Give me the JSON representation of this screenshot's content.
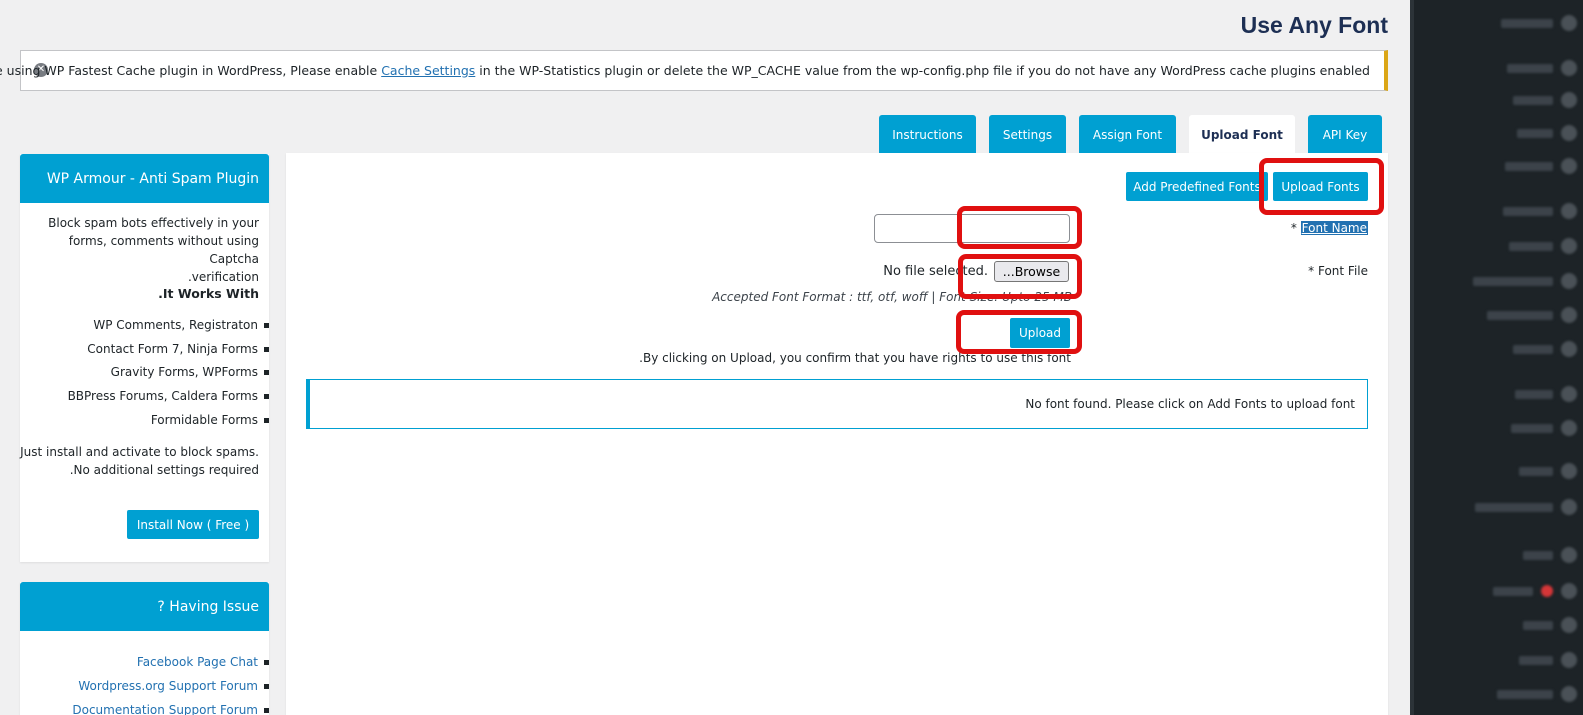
{
  "page": {
    "title": "Use Any Font"
  },
  "notice": {
    "text_before": ".You are using WP Fastest Cache plugin in WordPress, Please enable ",
    "link": "Cache Settings",
    "text_after": " in the WP-Statistics plugin or delete the WP_CACHE value from the wp-config.php file if you do not have any WordPress cache plugins enabled"
  },
  "tabs": [
    {
      "label": "Instructions",
      "active": false
    },
    {
      "label": "Settings",
      "active": false
    },
    {
      "label": "Assign Font",
      "active": false
    },
    {
      "label": "Upload Font",
      "active": true
    },
    {
      "label": "API Key",
      "active": false
    }
  ],
  "main": {
    "add_predefined_label": "Add Predefined Fonts",
    "upload_fonts_label": "Upload Fonts",
    "font_name_star": "* ",
    "font_name_label": "Font Name",
    "font_name_value": "",
    "font_file_label": "* Font File",
    "file_status": "No file selected.",
    "browse_label": "...Browse",
    "accepted_format": "Accepted Font Format : ttf, otf, woff | Font Size: Upto 25 MB",
    "upload_label": "Upload",
    "confirm_text": ".By clicking on Upload, you confirm that you have rights to use this font",
    "no_font_text": "No font found. Please click on Add Fonts to upload font"
  },
  "widget_armour": {
    "title": "WP Armour - Anti Spam Plugin",
    "desc_line1": "Block spam bots effectively in your",
    "desc_line2": "forms, comments without using Captcha",
    "desc_line3": ".verification",
    "works_with": ".It Works With",
    "items": [
      "WP Comments, Registraton",
      "Contact Form 7, Ninja Forms",
      "Gravity Forms, WPForms",
      "BBPress Forums, Caldera Forms",
      "Formidable Forms"
    ],
    "footer_line1": "Just install and activate to block spams.",
    "footer_line2": ".No additional settings required",
    "install_label": "Install Now ( Free )"
  },
  "widget_issue": {
    "title": "? Having Issue",
    "links": [
      "Facebook Page Chat",
      "Wordpress.org Support Forum",
      "Documentation Support Forum"
    ]
  },
  "colors": {
    "accent": "#00a0d2",
    "highlight_box": "#e01010",
    "sidebar_bg": "#1d2327"
  }
}
